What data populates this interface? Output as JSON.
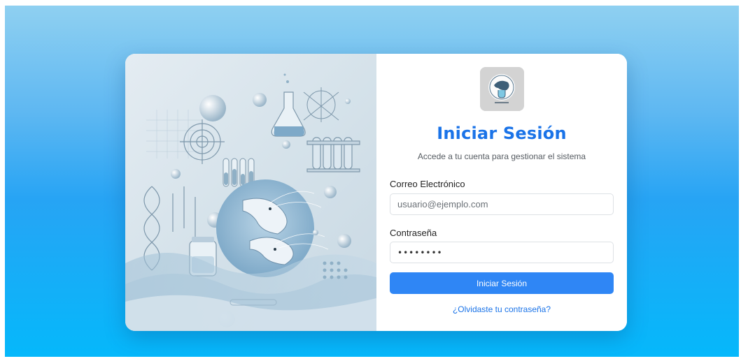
{
  "login": {
    "title": "Iniciar Sesión",
    "subtitle": "Accede a tu cuenta para gestionar el sistema",
    "email_label": "Correo Electrónico",
    "email_placeholder": "usuario@ejemplo.com",
    "password_label": "Contraseña",
    "password_value": "••••••••",
    "submit_label": "Iniciar Sesión",
    "forgot_link": "¿Olvidaste tu contraseña?"
  },
  "illustration": {
    "subject": "shrimp-lab-illustration"
  },
  "colors": {
    "background_gradient_top": "#8fd0f1",
    "background_gradient_bottom": "#05b8fb",
    "accent": "#1a73e8",
    "button": "#2f86f5"
  }
}
